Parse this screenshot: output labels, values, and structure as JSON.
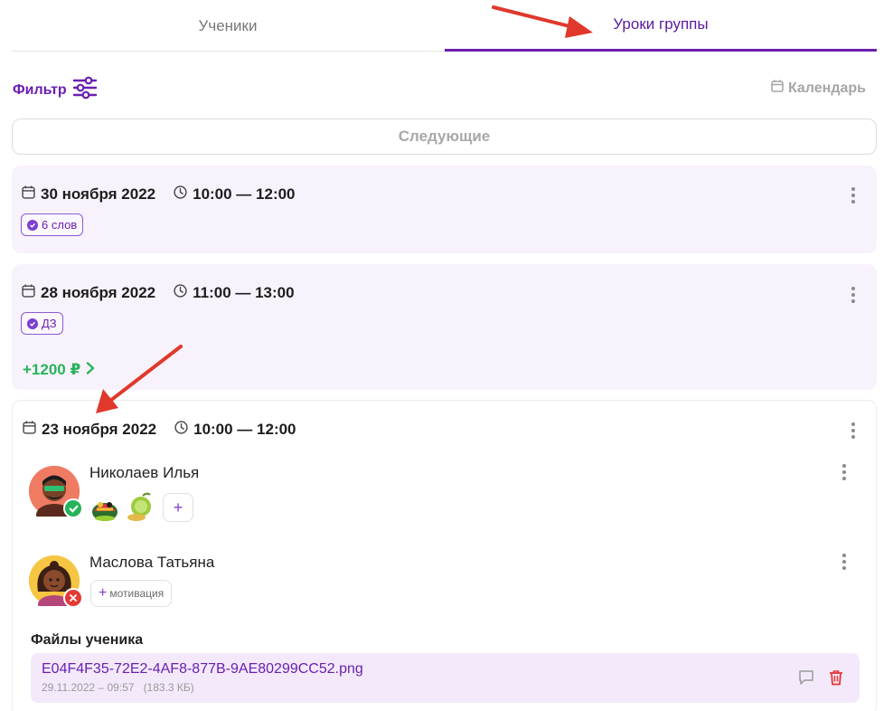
{
  "tabs": [
    {
      "label": "Ученики",
      "active": false
    },
    {
      "label": "Уроки группы",
      "active": true
    }
  ],
  "toolbar": {
    "filter_label": "Фильтр",
    "calendar_label": "Календарь"
  },
  "next_button": "Следующие",
  "lessons": [
    {
      "date": "30 ноября 2022",
      "time": "10:00 — 12:00",
      "tag": "6 слов"
    },
    {
      "date": "28 ноября 2022",
      "time": "11:00 — 13:00",
      "tag": "ДЗ",
      "price": "+1200 ₽"
    },
    {
      "date": "23 ноября 2022",
      "time": "10:00 — 12:00",
      "students": [
        {
          "name": "Николаев Илья",
          "status": "present",
          "add_label": "+"
        },
        {
          "name": "Маслова Татьяна",
          "status": "absent",
          "motivation_label": "мотивация"
        }
      ],
      "files_title": "Файлы ученика",
      "file": {
        "name": "E04F4F35-72E2-4AF8-877B-9AE80299CC52.png",
        "date": "29.11.2022 – 09:57",
        "size": "(183.3 КБ)"
      }
    }
  ],
  "colors": {
    "accent": "#6a1fb0",
    "pink_card": "#f8f2fc",
    "present": "#27b35a",
    "absent": "#e53935",
    "annotation_arrow": "#e0382b"
  }
}
